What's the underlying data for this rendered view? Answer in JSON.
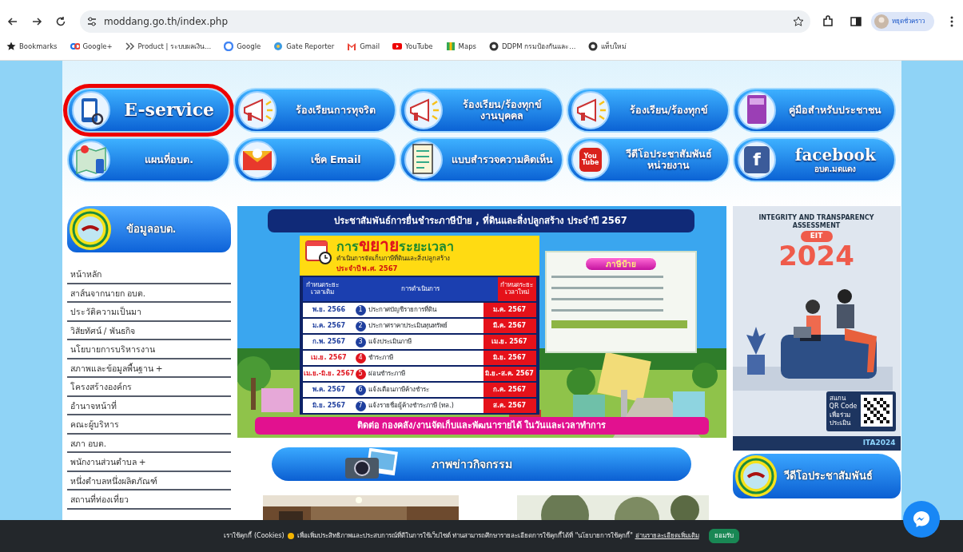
{
  "browser": {
    "url": "moddang.go.th/index.php",
    "profile": "หยุดชั่วคราว",
    "bookmarks": [
      {
        "label": "Bookmarks"
      },
      {
        "label": "Google+"
      },
      {
        "label": "Product | ระบบผลเงิน..."
      },
      {
        "label": "Google"
      },
      {
        "label": "Gate Reporter"
      },
      {
        "label": "Gmail"
      },
      {
        "label": "YouTube"
      },
      {
        "label": "Maps"
      },
      {
        "label": "DDPM กรมป้องกันและ..."
      },
      {
        "label": "แท็บใหม่"
      }
    ]
  },
  "quick_links": [
    {
      "lines": [
        "E-service"
      ],
      "highlighted": true
    },
    {
      "lines": [
        "ร้องเรียนการทุจริต"
      ],
      "highlighted": false
    },
    {
      "lines": [
        "ร้องเรียน/ร้องทุกข์",
        "งานบุคคล"
      ],
      "highlighted": false
    },
    {
      "lines": [
        "ร้องเรียน/ร้องทุกข์"
      ],
      "highlighted": false
    },
    {
      "lines": [
        "คู่มือสำหรับประชาชน"
      ],
      "highlighted": false
    },
    {
      "lines": [
        "แผนที่อบต."
      ],
      "highlighted": false
    },
    {
      "lines": [
        "เช็ค Email"
      ],
      "highlighted": false
    },
    {
      "lines": [
        "แบบสำรวจความคิดเห็น"
      ],
      "highlighted": false
    },
    {
      "lines": [
        "วีดีโอประชาสัมพันธ์",
        "หน่วยงาน"
      ],
      "highlighted": false,
      "icon_text": [
        "You",
        "Tube"
      ]
    },
    {
      "lines": [
        "facebook",
        "อบต.มดแดง"
      ],
      "highlighted": false,
      "icon_text": [
        "f"
      ]
    }
  ],
  "sidebar": {
    "title": "ข้อมูลอบต.",
    "items": [
      "หน้าหลัก",
      "สาส์นจากนายก อบต.",
      "ประวัติความเป็นมา",
      "วิสัยทัศน์ / พันธกิจ",
      "นโยบายการบริหารงาน",
      "สภาพและข้อมูลพื้นฐาน +",
      "โครงสร้างองค์กร",
      "อำนาจหน้าที่",
      "คณะผู้บริหาร",
      "สภา อบต.",
      "พนักงานส่วนตำบล +",
      "หนึ่งตำบลหนึ่งผลิตภัณฑ์",
      "สถานที่ท่องเที่ยว"
    ]
  },
  "tax_banner": {
    "title": "ประชาสัมพันธ์การยื่นชำระภาษีป้าย , ที่ดินและสิ่งปลูกสร้าง ประจำปี 2567",
    "heading": [
      "การ",
      "ขยาย",
      "ระยะเวลา"
    ],
    "subtitle": "ดำเนินการจัดเก็บภาษีที่ดินและสิ่งปลูกสร้าง",
    "year": "ประจำปี พ.ศ. 2567",
    "columns": [
      "กำหนดระยะเวลาเดิม",
      "การดำเนินการ",
      "กำหนดระยะเวลาใหม่"
    ],
    "rows": [
      {
        "number": "1",
        "old": "พ.ย. 2566",
        "action": "ประกาศบัญชีรายการที่ดิน",
        "new": "ม.ค. 2567",
        "color": "#1f3f9e"
      },
      {
        "number": "2",
        "old": "ม.ค. 2567",
        "action": "ประกาศราคาประเมินทุนทรัพย์",
        "new": "มี.ค. 2567",
        "color": "#1f3f9e"
      },
      {
        "number": "3",
        "old": "ก.พ. 2567",
        "action": "แจ้งประเมินภาษี",
        "new": "เม.ย. 2567",
        "color": "#1f3f9e"
      },
      {
        "number": "4",
        "old": "เม.ย. 2567",
        "action": "ชำระภาษี",
        "new": "มิ.ย. 2567",
        "color": "#e0141e"
      },
      {
        "number": "5",
        "old": "เม.ย.-มิ.ย. 2567",
        "action": "ผ่อนชำระภาษี",
        "new": "มิ.ย.-ส.ค. 2567",
        "color": "#e0141e"
      },
      {
        "number": "6",
        "old": "พ.ค. 2567",
        "action": "แจ้งเตือนภาษีค้างชำระ",
        "new": "ก.ค. 2567",
        "color": "#1f3f9e"
      },
      {
        "number": "7",
        "old": "มิ.ย. 2567",
        "action": "แจ้งรายชื่อผู้ค้างชำระภาษี (ทล.)",
        "new": "ส.ค. 2567",
        "color": "#1f3f9e"
      }
    ],
    "sign_title": "ภาษีป้าย",
    "footer": "ติดต่อ  กองคลัง/งานจัดเก็บและพัฒนารายได้  ในวันและเวลาทำการ"
  },
  "news": {
    "title": "ภาพข่าวกิจกรรม"
  },
  "ita_poster": {
    "heading": [
      "INTEGRITY AND TRANSPARENCY",
      "ASSESSMENT"
    ],
    "badge": "EIT",
    "year": "2024",
    "qr_label": [
      "สแกน",
      "QR Code",
      "เพื่อร่วม",
      "ประเมิน"
    ],
    "brand": "ITA2024"
  },
  "video": {
    "title": "วีดีโอประชาสัมพันธ์"
  },
  "cookie_bar": {
    "lead": "เราใช้คุกกี้ (Cookies)",
    "text": "เพื่อเพิ่มประสิทธิภาพและประสบการณ์ที่ดีในการใช้เว็บไซต์ ท่านสามารถศึกษารายละเอียดการใช้คุกกี้ได้ที่ \"นโยบายการใช้คุกกี้\"",
    "link": "อ่านรายละเอียดเพิ่มเติม",
    "button": "ยอมรับ"
  }
}
